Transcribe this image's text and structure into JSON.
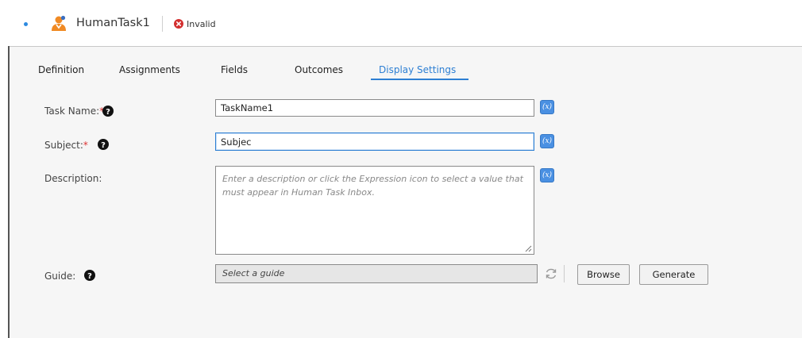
{
  "header": {
    "task_title": "HumanTask1",
    "status": "Invalid",
    "task_icon": "user-person-icon",
    "status_icon": "error-x-circle-icon",
    "colors": {
      "accent": "#2d7fd3",
      "error": "#d32f2f",
      "person_orange": "#f08a24"
    }
  },
  "tabs": [
    {
      "label": "Definition"
    },
    {
      "label": "Assignments"
    },
    {
      "label": "Fields"
    },
    {
      "label": "Outcomes"
    },
    {
      "label": "Display Settings",
      "active": true
    }
  ],
  "form": {
    "task_name": {
      "label": "Task Name:",
      "required_mark": "*",
      "value": "TaskName1"
    },
    "subject": {
      "label": "Subject:",
      "required_mark": "*",
      "value": "Subjec"
    },
    "description": {
      "label": "Description:",
      "placeholder": "Enter a description or click the Expression icon to select a value that must appear in Human Task Inbox."
    },
    "guide": {
      "label": "Guide:",
      "placeholder": "Select a guide"
    },
    "expression_icon_text": "(x)",
    "browse_label": "Browse",
    "generate_label": "Generate"
  }
}
